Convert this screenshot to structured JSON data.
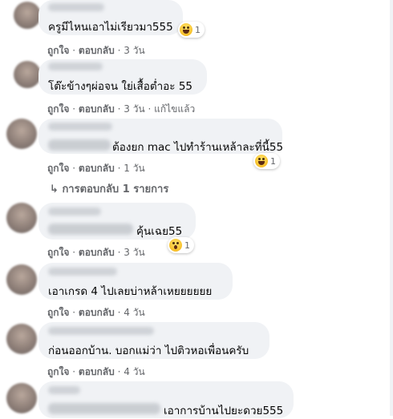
{
  "comments": [
    {
      "text": "ครูมีไหนเอาไม่เรียวมา555",
      "reaction_count": "1",
      "reaction_type": "haha",
      "actions": {
        "like": "ถูกใจ",
        "reply": "ตอบกลับ",
        "time": "3 วัน"
      }
    },
    {
      "text": "โต๊ะข้างๆผ่อจน ใย่เสื้อต่ำอะ 55",
      "actions": {
        "like": "ถูกใจ",
        "reply": "ตอบกลับ",
        "time": "3 วัน",
        "edited": "แก้ไขแล้ว"
      }
    },
    {
      "text": "ต้องยก mac ไปทำร้านเหล้าละที่นี้55",
      "reaction_count": "1",
      "reaction_type": "haha",
      "actions": {
        "like": "ถูกใจ",
        "reply": "ตอบกลับ",
        "time": "1 วัน"
      },
      "replies_link": "การตอบกลับ 1 รายการ"
    },
    {
      "text": "คุ้นเฉย55",
      "reaction_count": "1",
      "reaction_type": "wow",
      "actions": {
        "like": "ถูกใจ",
        "reply": "ตอบกลับ",
        "time": "3 วัน"
      }
    },
    {
      "text": "เอาเกรด 4 ไปเลยบ่าหล้าเหยยยยยย",
      "actions": {
        "like": "ถูกใจ",
        "reply": "ตอบกลับ",
        "time": "4 วัน"
      }
    },
    {
      "text": "ก่อนออกบ้าน. บอกแม่ว่า ไปติวหอเพื่อนครับ",
      "actions": {
        "like": "ถูกใจ",
        "reply": "ตอบกลับ",
        "time": "4 วัน"
      }
    },
    {
      "text": "เอาการบ้านไปยะดวย555"
    }
  ],
  "separator": "·",
  "reply_arrow": "↳"
}
